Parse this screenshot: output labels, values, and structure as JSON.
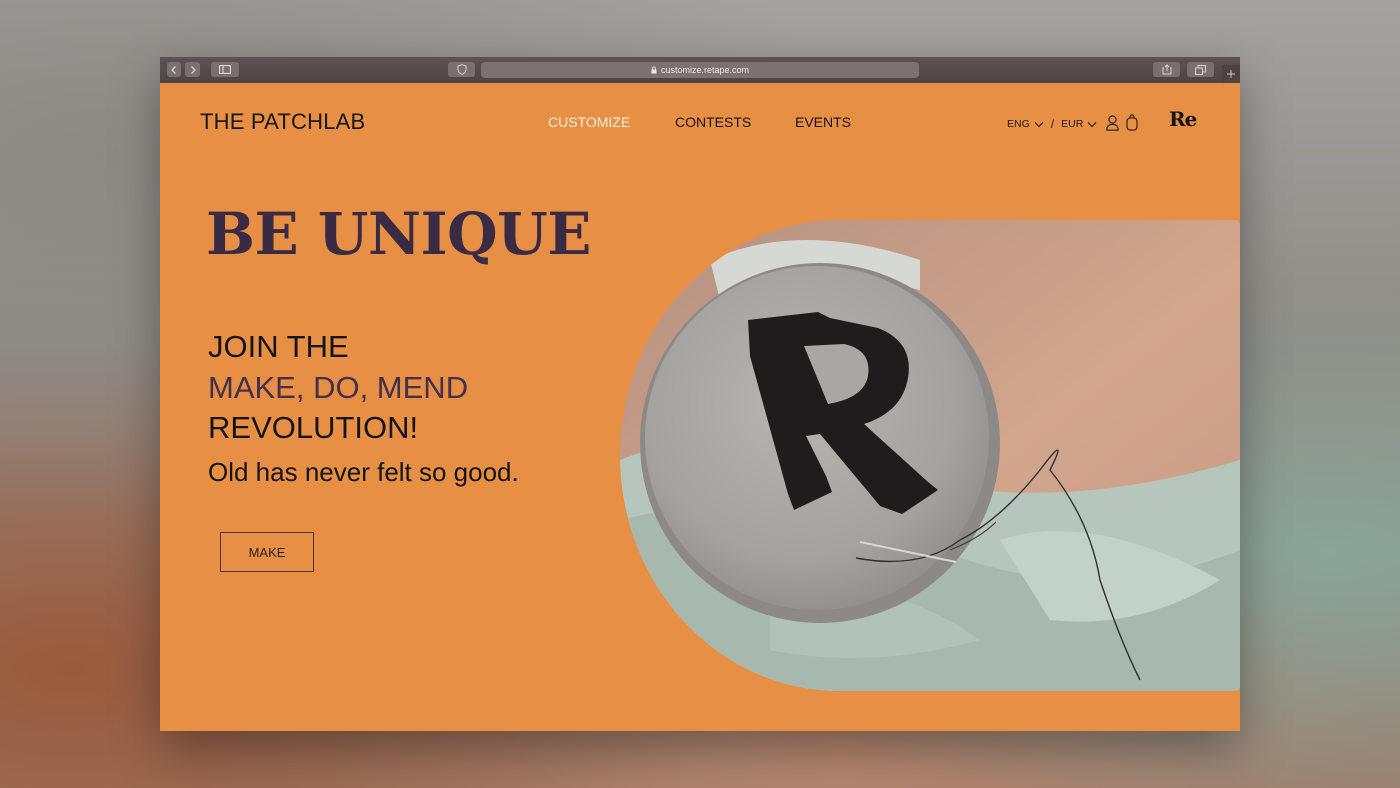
{
  "browser": {
    "url": "customize.retape.com"
  },
  "header": {
    "brand": "THE PATCHLAB",
    "nav": [
      "CUSTOMIZE",
      "CONTESTS",
      "EVENTS"
    ],
    "active_nav": "CUSTOMIZE",
    "language": "ENG",
    "separator": "/",
    "currency": "EUR",
    "logo_mark": "Re"
  },
  "hero": {
    "title": "BE UNIQUE",
    "line1": "JOIN THE",
    "line2": "MAKE, DO, MEND",
    "line3": "REVOLUTION!",
    "tagline": "Old has never felt so good.",
    "cta": "MAKE",
    "image_letter": "R"
  },
  "colors": {
    "page_bg": "#e78f45",
    "title": "#3a2b44",
    "accent_line": "#43304a",
    "active_nav": "#fbeee0"
  },
  "icons": [
    "back-icon",
    "forward-icon",
    "sidebar-icon",
    "shield-icon",
    "lock-icon",
    "share-icon",
    "tabs-icon",
    "new-tab-icon",
    "chevron-down-icon",
    "user-icon",
    "bag-icon"
  ]
}
